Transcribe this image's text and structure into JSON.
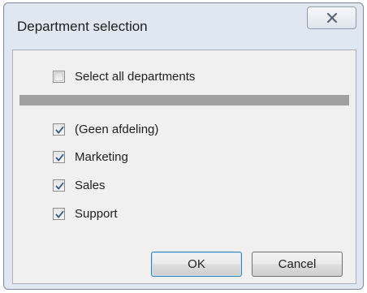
{
  "window": {
    "title": "Department selection"
  },
  "select_all": {
    "label": "Select all departments",
    "checked": false
  },
  "departments": [
    {
      "label": "(Geen afdeling)",
      "checked": true
    },
    {
      "label": "Marketing",
      "checked": true
    },
    {
      "label": "Sales",
      "checked": true
    },
    {
      "label": "Support",
      "checked": true
    }
  ],
  "buttons": {
    "ok_label": "OK",
    "cancel_label": "Cancel"
  },
  "icons": {
    "close": "close-icon",
    "check": "checkmark-icon"
  }
}
